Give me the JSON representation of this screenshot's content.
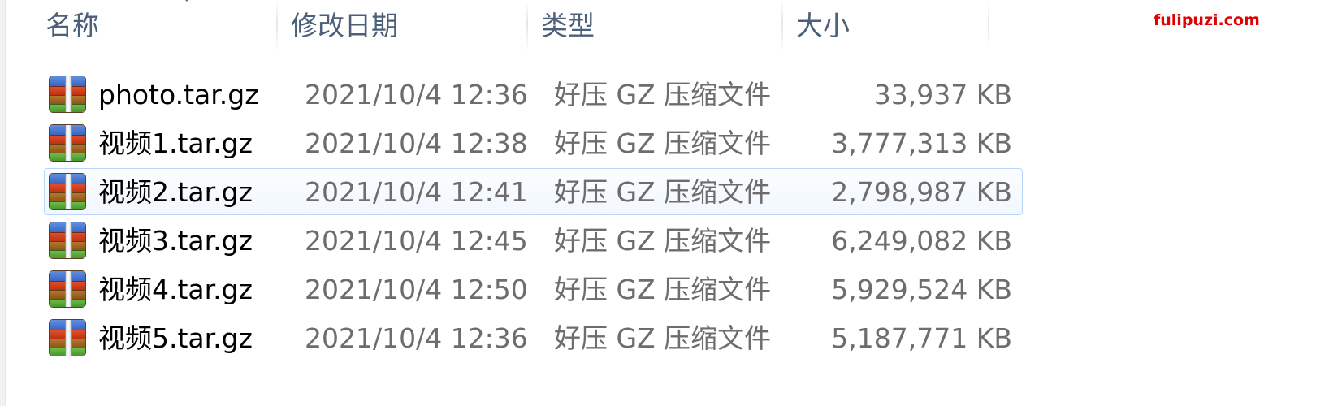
{
  "columns": {
    "name": "名称",
    "date": "修改日期",
    "type": "类型",
    "size": "大小"
  },
  "files": [
    {
      "name": "photo.tar.gz",
      "date": "2021/10/4 12:36",
      "type": "好压 GZ 压缩文件",
      "size": "33,937 KB",
      "icon": "archive-icon"
    },
    {
      "name": "视频1.tar.gz",
      "date": "2021/10/4 12:38",
      "type": "好压 GZ 压缩文件",
      "size": "3,777,313 KB",
      "icon": "archive-icon"
    },
    {
      "name": "视频2.tar.gz",
      "date": "2021/10/4 12:41",
      "type": "好压 GZ 压缩文件",
      "size": "2,798,987 KB",
      "icon": "archive-icon",
      "selected": true
    },
    {
      "name": "视频3.tar.gz",
      "date": "2021/10/4 12:45",
      "type": "好压 GZ 压缩文件",
      "size": "6,249,082 KB",
      "icon": "archive-icon"
    },
    {
      "name": "视频4.tar.gz",
      "date": "2021/10/4 12:50",
      "type": "好压 GZ 压缩文件",
      "size": "5,929,524 KB",
      "icon": "archive-icon"
    },
    {
      "name": "视频5.tar.gz",
      "date": "2021/10/4 12:36",
      "type": "好压 GZ 压缩文件",
      "size": "5,187,771 KB",
      "icon": "archive-icon"
    }
  ],
  "watermark": "fulipuzi.com",
  "colors": {
    "header_text": "#4c607a",
    "selection_border": "#b8d6fb",
    "watermark": "#e00000"
  }
}
